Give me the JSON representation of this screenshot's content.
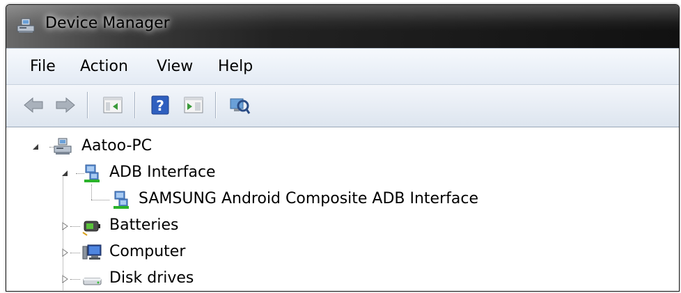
{
  "window": {
    "title": "Device Manager"
  },
  "menu": {
    "items": [
      "File",
      "Action",
      "View",
      "Help"
    ]
  },
  "toolbar": {
    "buttons": [
      {
        "icon": "back-arrow-icon"
      },
      {
        "icon": "forward-arrow-icon"
      },
      {
        "icon": "show-hide-console-tree-icon"
      },
      {
        "icon": "help-icon"
      },
      {
        "icon": "properties-icon"
      },
      {
        "icon": "scan-hardware-changes-icon"
      }
    ]
  },
  "tree": {
    "root": {
      "label": "Aatoo-PC",
      "expanded": true,
      "icon": "computer-root-icon"
    },
    "nodes": [
      {
        "label": "ADB Interface",
        "expanded": true,
        "icon": "adb-interface-icon"
      },
      {
        "label": "SAMSUNG Android Composite ADB Interface",
        "icon": "adb-interface-icon"
      },
      {
        "label": "Batteries",
        "expanded": false,
        "icon": "battery-icon"
      },
      {
        "label": "Computer",
        "expanded": false,
        "icon": "monitor-icon"
      },
      {
        "label": "Disk drives",
        "expanded": false,
        "icon": "disk-drive-icon"
      }
    ]
  },
  "colors": {
    "titlebar_dark": "#111111",
    "menubar": "#e3eaf4",
    "toolbar": "#dde5ef",
    "adb_icon_green": "#2bb32b"
  }
}
